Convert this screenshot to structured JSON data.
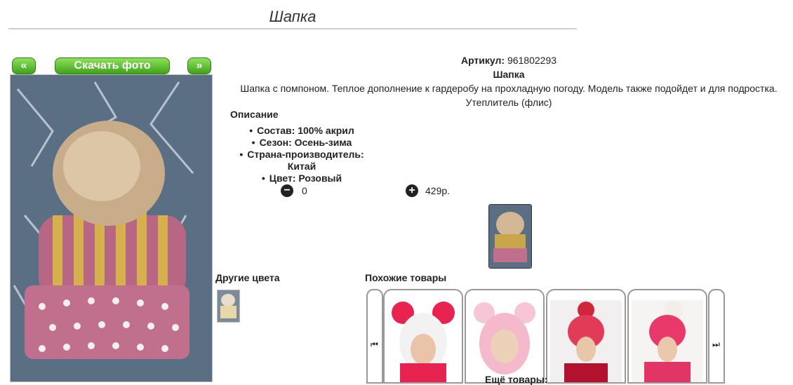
{
  "title": "Шапка",
  "nav": {
    "prev": "«",
    "download": "Скачать фото",
    "next": "»"
  },
  "product": {
    "article_label": "Артикул:",
    "article": "961802293",
    "name": "Шапка",
    "description": "Шапка с помпоном. Теплое дополнение к гардеробу на прохладную погоду. Модель также подойдет и для подростка.",
    "description2": "Утеплитель (флис)",
    "desc_heading": "Описание",
    "props": [
      "Состав: 100% акрил",
      "Сезон: Осень-зима",
      "Страна-производитель: Китай",
      "Цвет: Розовый"
    ]
  },
  "quantity": {
    "minus": "−",
    "value": "0",
    "plus": "+",
    "price": "429р."
  },
  "sections": {
    "other_colors": "Другие цвета",
    "similar": "Похожие товары",
    "more": "Ещё товары:"
  },
  "colors": {
    "accent": "#4caf1e",
    "hat_pink": "#c86a86",
    "hat_gold": "#c8a548"
  }
}
